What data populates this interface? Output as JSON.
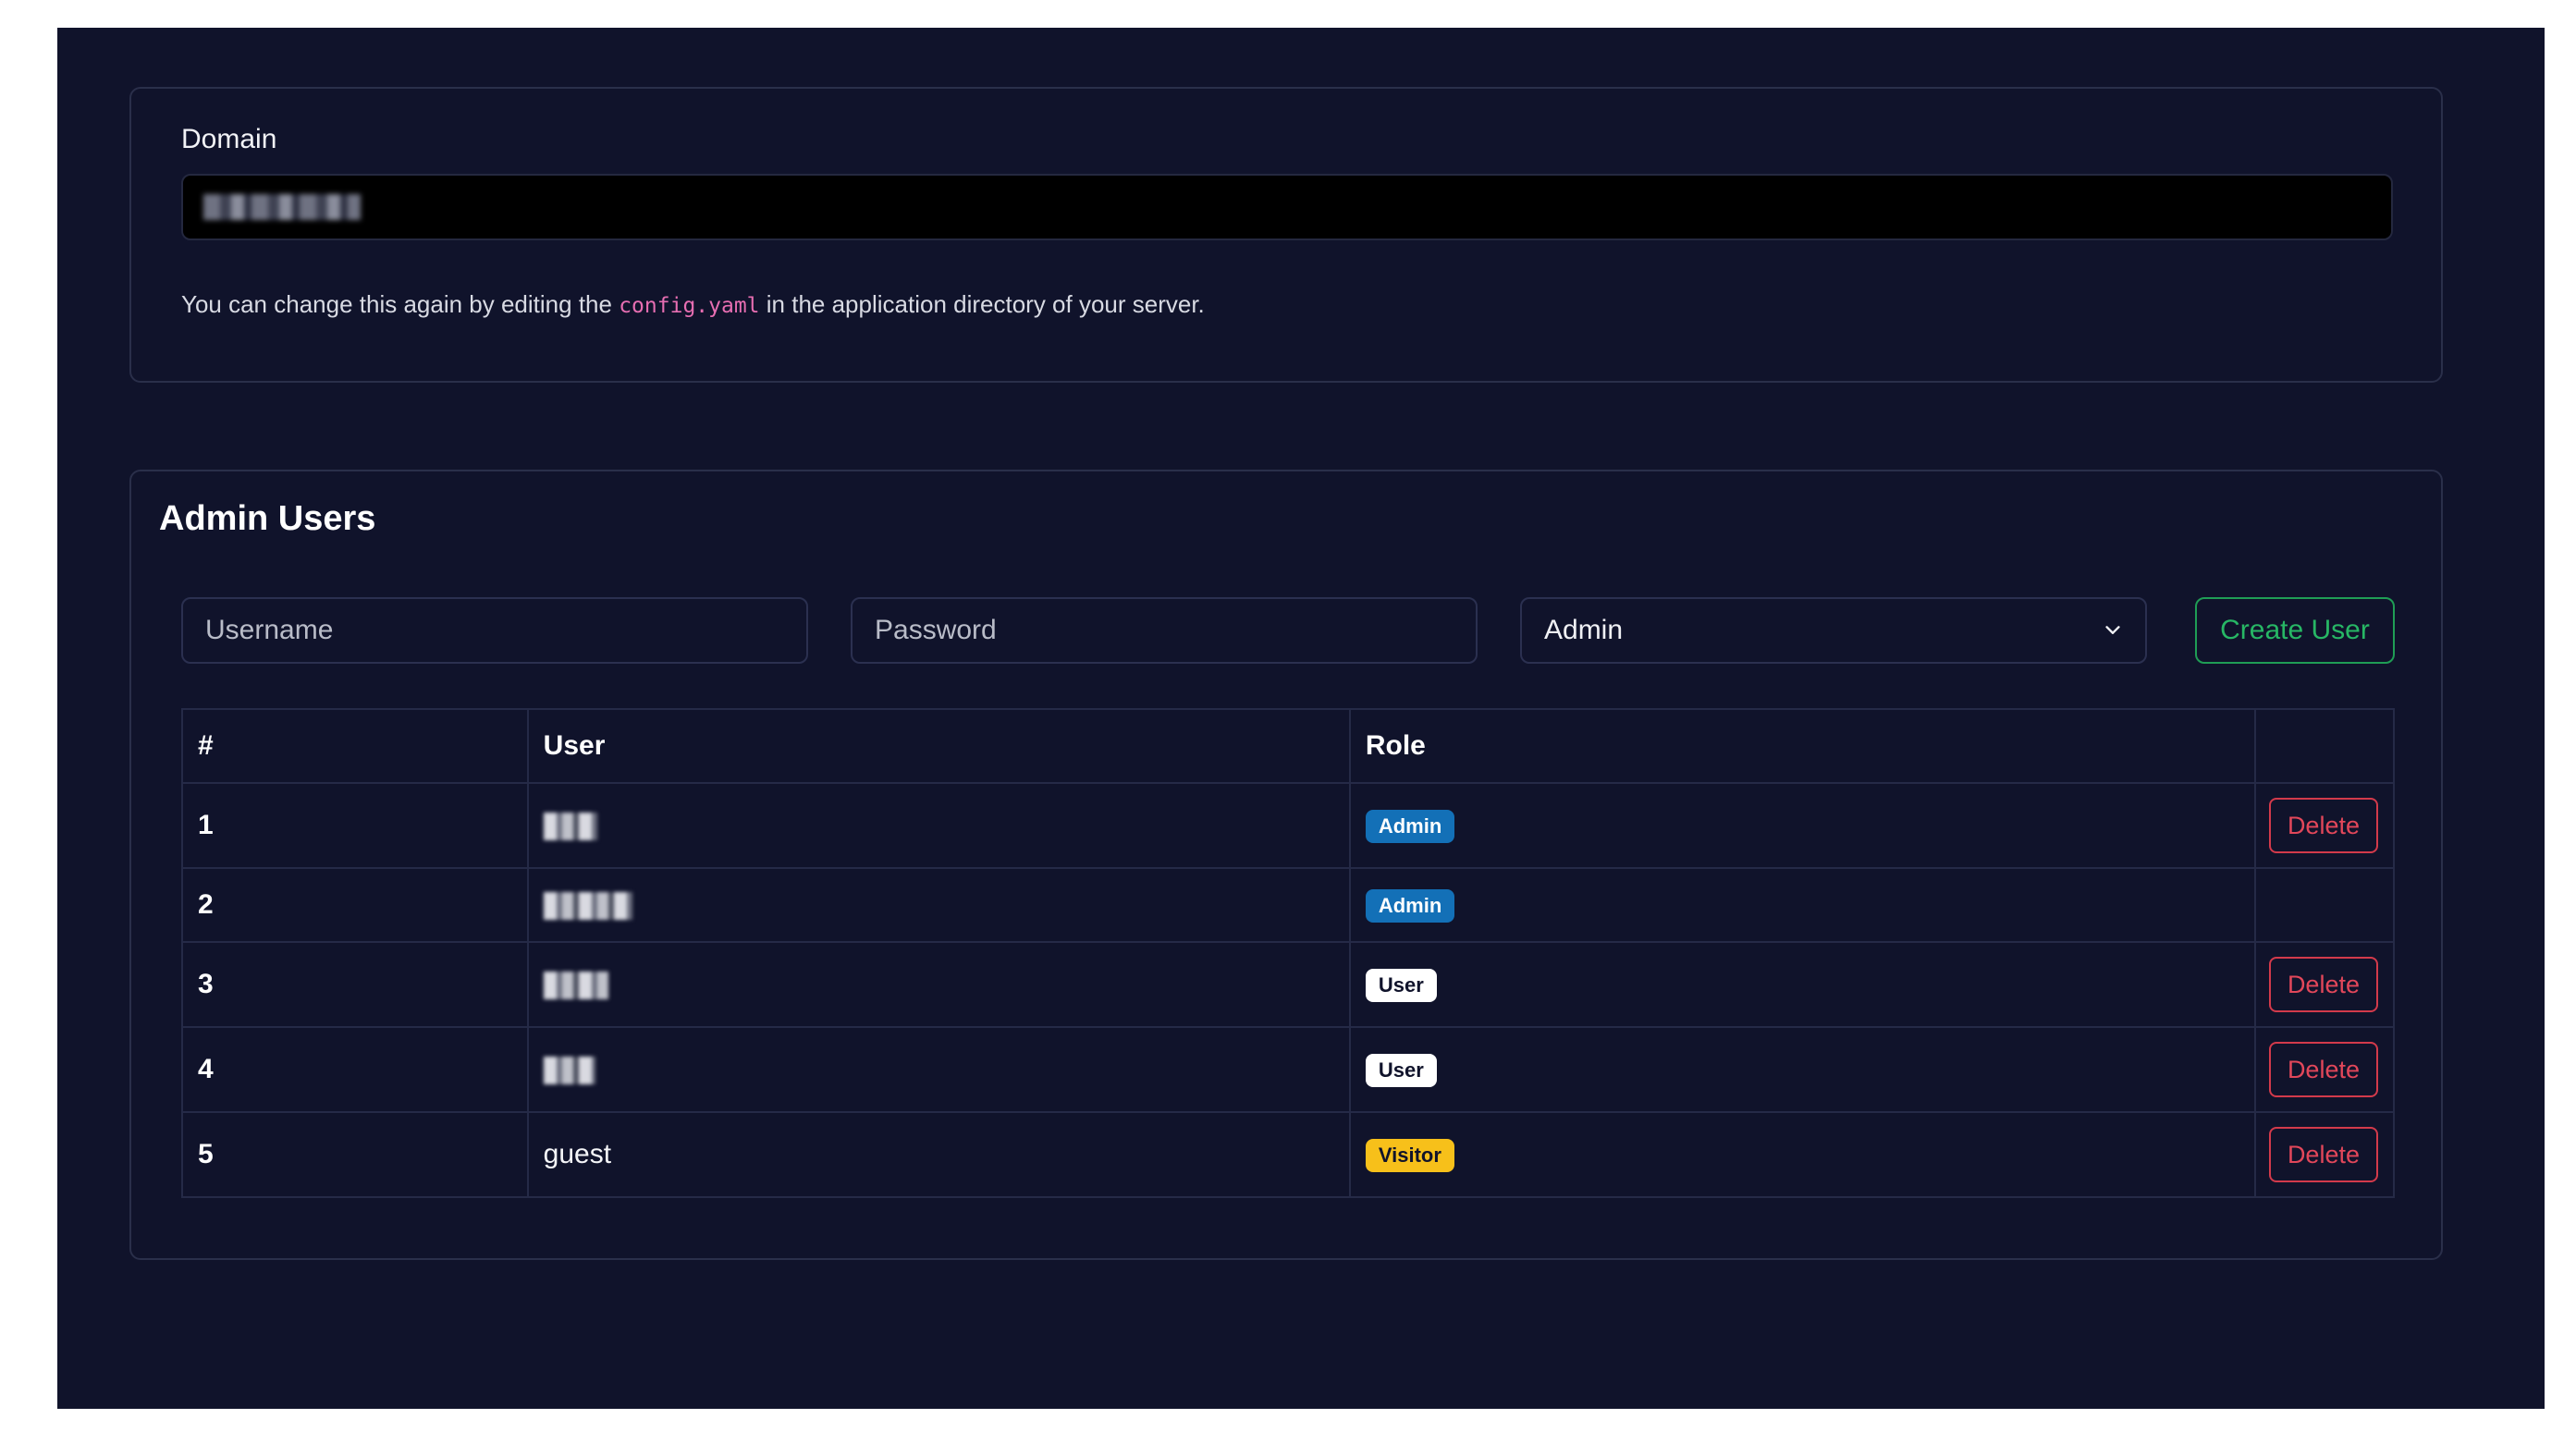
{
  "domain": {
    "label": "Domain",
    "value_redacted": true,
    "help_prefix": "You can change this again by editing the",
    "help_code": "config.yaml",
    "help_suffix": "in the application directory of your server."
  },
  "users": {
    "title": "Admin Users",
    "username_placeholder": "Username",
    "password_placeholder": "Password",
    "role_selected": "Admin",
    "create_label": "Create User",
    "columns": [
      "#",
      "User",
      "Role",
      ""
    ],
    "delete_label": "Delete",
    "rows": [
      {
        "num": "1",
        "user": "",
        "role": "Admin"
      },
      {
        "num": "2",
        "user": "",
        "role": "Admin"
      },
      {
        "num": "3",
        "user": "",
        "role": "User"
      },
      {
        "num": "4",
        "user": "",
        "role": "User"
      },
      {
        "num": "5",
        "user": "guest",
        "role": "Visitor"
      }
    ]
  },
  "colors": {
    "background": "#10132b",
    "border": "#2a2f4a",
    "success": "#1f9d55",
    "danger": "#d33a4b",
    "admin_badge": "#1370b7",
    "visitor_badge": "#f7c01a",
    "code": "#e76eb2"
  },
  "icons": {
    "select_chevron": "chevron-down-icon"
  }
}
